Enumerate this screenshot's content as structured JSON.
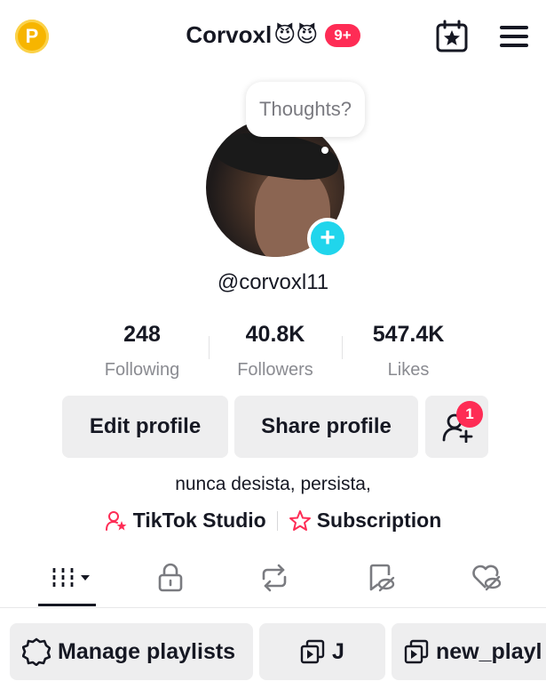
{
  "header": {
    "coin_letter": "P",
    "title": "Corvoxl",
    "title_emojis": "😈😈",
    "notification_badge": "9+"
  },
  "profile": {
    "thoughts_placeholder": "Thoughts?",
    "handle": "@corvoxl11",
    "bio": "nunca desista, persista,"
  },
  "stats": [
    {
      "value": "248",
      "label": "Following"
    },
    {
      "value": "40.8K",
      "label": "Followers"
    },
    {
      "value": "547.4K",
      "label": "Likes"
    }
  ],
  "actions": {
    "edit_label": "Edit profile",
    "share_label": "Share profile",
    "add_friends_badge": "1"
  },
  "links": {
    "studio_label": "TikTok Studio",
    "subscription_label": "Subscription"
  },
  "tabs": [
    "videos-grid",
    "private-lock",
    "reposts",
    "favorites",
    "liked-hidden"
  ],
  "playlists": {
    "manage_label": "Manage playlists",
    "items": [
      "J",
      "new_playl"
    ]
  },
  "colors": {
    "accent": "#fe2c55",
    "add_button": "#20d5ec",
    "coin": "#f7b500",
    "studio_icon": "#fe2c55"
  }
}
